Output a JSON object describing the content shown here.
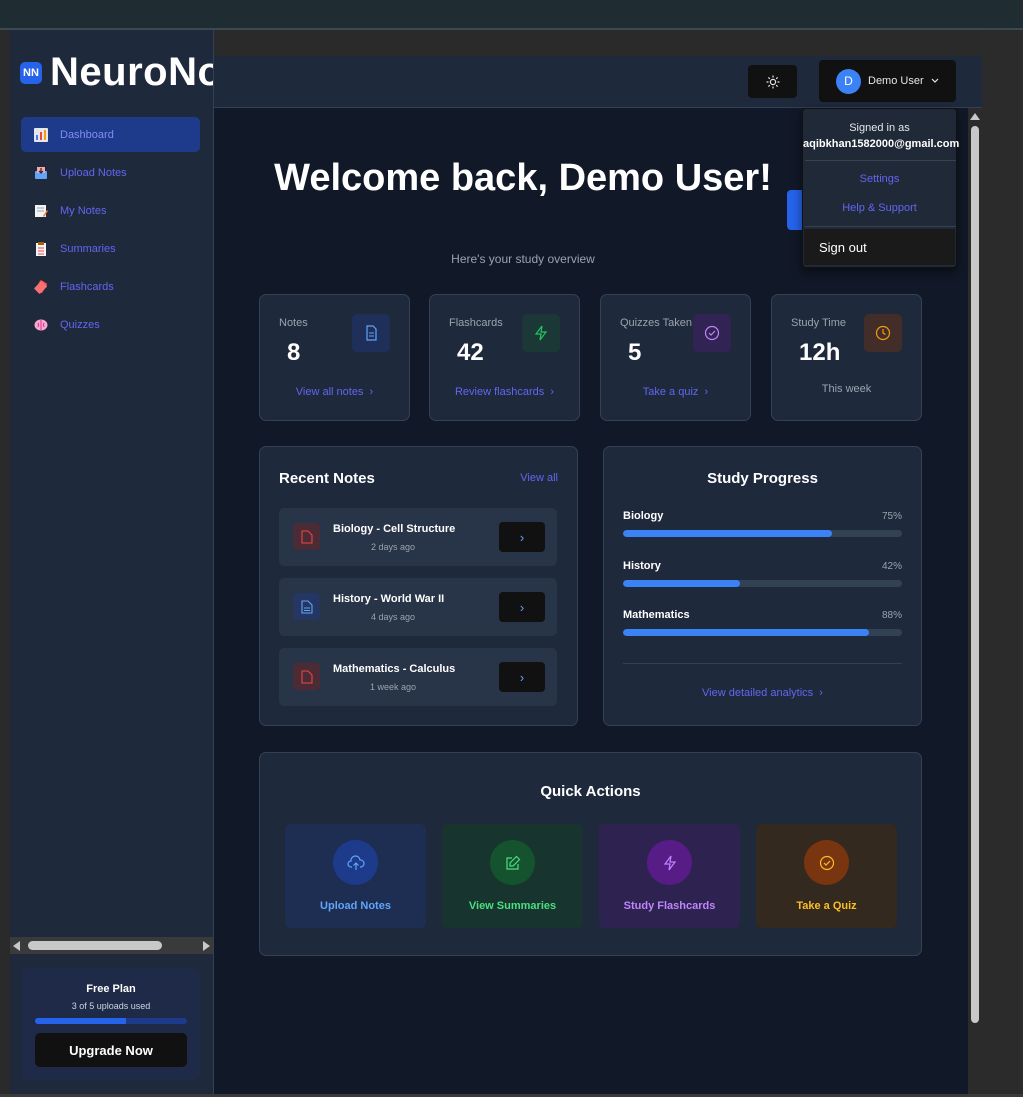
{
  "app": {
    "logo_badge": "NN",
    "logo_text": "NeuroNo"
  },
  "sidebar": {
    "items": [
      {
        "label": "Dashboard",
        "icon": "bar-chart-icon",
        "active": true
      },
      {
        "label": "Upload Notes",
        "icon": "inbox-tray-icon"
      },
      {
        "label": "My Notes",
        "icon": "memo-icon"
      },
      {
        "label": "Summaries",
        "icon": "clipboard-icon"
      },
      {
        "label": "Flashcards",
        "icon": "cards-icon"
      },
      {
        "label": "Quizzes",
        "icon": "brain-icon"
      }
    ],
    "plan": {
      "title": "Free Plan",
      "usage": "3 of 5 uploads used",
      "usage_fraction": 0.6,
      "upgrade_label": "Upgrade Now"
    }
  },
  "header": {
    "avatar_initial": "D",
    "user_name": "Demo User"
  },
  "main": {
    "welcome": "Welcome back, Demo User!",
    "subtitle": "Here's your study overview",
    "stats": [
      {
        "label": "Notes",
        "value": "8",
        "link": "View all notes",
        "icon": "document-icon",
        "accent": "#3b82f6"
      },
      {
        "label": "Flashcards",
        "value": "42",
        "link": "Review flashcards",
        "icon": "lightning-icon",
        "accent": "#22c55e"
      },
      {
        "label": "Quizzes Taken",
        "value": "5",
        "link": "Take a quiz",
        "icon": "check-circle-icon",
        "accent": "#a855f7"
      },
      {
        "label": "Study Time",
        "value": "12h",
        "note": "This week",
        "icon": "clock-icon",
        "accent": "#f59e0b"
      }
    ],
    "recent_notes": {
      "title": "Recent Notes",
      "view_all": "View all",
      "items": [
        {
          "title": "Biology - Cell Structure",
          "date": "2 days ago",
          "color": "#ef4444"
        },
        {
          "title": "History - World War II",
          "date": "4 days ago",
          "color": "#3b82f6"
        },
        {
          "title": "Mathematics - Calculus",
          "date": "1 week ago",
          "color": "#ef4444"
        }
      ]
    },
    "study_progress": {
      "title": "Study Progress",
      "subjects": [
        {
          "name": "Biology",
          "percent_label": "75%",
          "value": 75
        },
        {
          "name": "History",
          "percent_label": "42%",
          "value": 42
        },
        {
          "name": "Mathematics",
          "percent_label": "88%",
          "value": 88
        }
      ],
      "analytics_link": "View detailed analytics"
    },
    "quick_actions": {
      "title": "Quick Actions",
      "items": [
        {
          "label": "Upload Notes",
          "icon": "upload-cloud-icon",
          "color": "#60a5fa"
        },
        {
          "label": "View Summaries",
          "icon": "edit-icon",
          "color": "#4ade80"
        },
        {
          "label": "Study Flashcards",
          "icon": "lightning-icon",
          "color": "#c084fc"
        },
        {
          "label": "Take a Quiz",
          "icon": "check-circle-icon",
          "color": "#fbbf24"
        }
      ]
    }
  },
  "user_menu": {
    "signed_in_as": "Signed in as",
    "email": "aqibkhan1582000@gmail.com",
    "settings": "Settings",
    "help": "Help & Support",
    "sign_out": "Sign out"
  }
}
